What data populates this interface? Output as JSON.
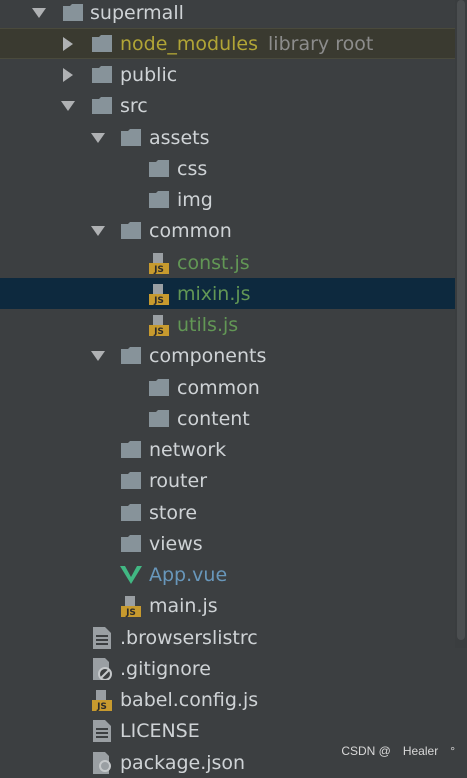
{
  "tree": {
    "root": {
      "label": "supermall",
      "expanded": true
    },
    "node_modules": {
      "label": "node_modules",
      "suffix": "library root",
      "expanded": false
    },
    "public": {
      "label": "public",
      "expanded": false
    },
    "src": {
      "label": "src",
      "expanded": true
    },
    "assets": {
      "label": "assets",
      "expanded": true
    },
    "css": {
      "label": "css"
    },
    "img": {
      "label": "img"
    },
    "common": {
      "label": "common",
      "expanded": true
    },
    "const_js": {
      "label": "const.js",
      "icon": "js-file-icon"
    },
    "mixin_js": {
      "label": "mixin.js",
      "icon": "js-file-icon",
      "selected": true
    },
    "utils_js": {
      "label": "utils.js",
      "icon": "js-file-icon"
    },
    "components": {
      "label": "components",
      "expanded": true
    },
    "components_common": {
      "label": "common"
    },
    "content": {
      "label": "content"
    },
    "network": {
      "label": "network"
    },
    "router": {
      "label": "router"
    },
    "store": {
      "label": "store"
    },
    "views": {
      "label": "views"
    },
    "app_vue": {
      "label": "App.vue",
      "icon": "vue-file-icon"
    },
    "main_js": {
      "label": "main.js",
      "icon": "js-file-icon"
    },
    "browserslistrc": {
      "label": ".browserslistrc",
      "icon": "text-file-icon"
    },
    "gitignore": {
      "label": ".gitignore",
      "icon": "ignore-file-icon"
    },
    "babel_config": {
      "label": "babel.config.js",
      "icon": "js-file-icon"
    },
    "license": {
      "label": "LICENSE",
      "icon": "text-file-icon"
    },
    "package_json": {
      "label": "package.json",
      "icon": "json-file-icon"
    }
  },
  "colors": {
    "background": "#3c3f41",
    "selected_row": "#0d293e",
    "text": "#cfd3d6",
    "vcs_added": "#629755",
    "library": "#b1a536",
    "vue_blue": "#6897bb",
    "folder": "#87939a",
    "js_badge": "#c79a2e"
  },
  "watermark": {
    "text": "CSDN @　Healer　°"
  }
}
